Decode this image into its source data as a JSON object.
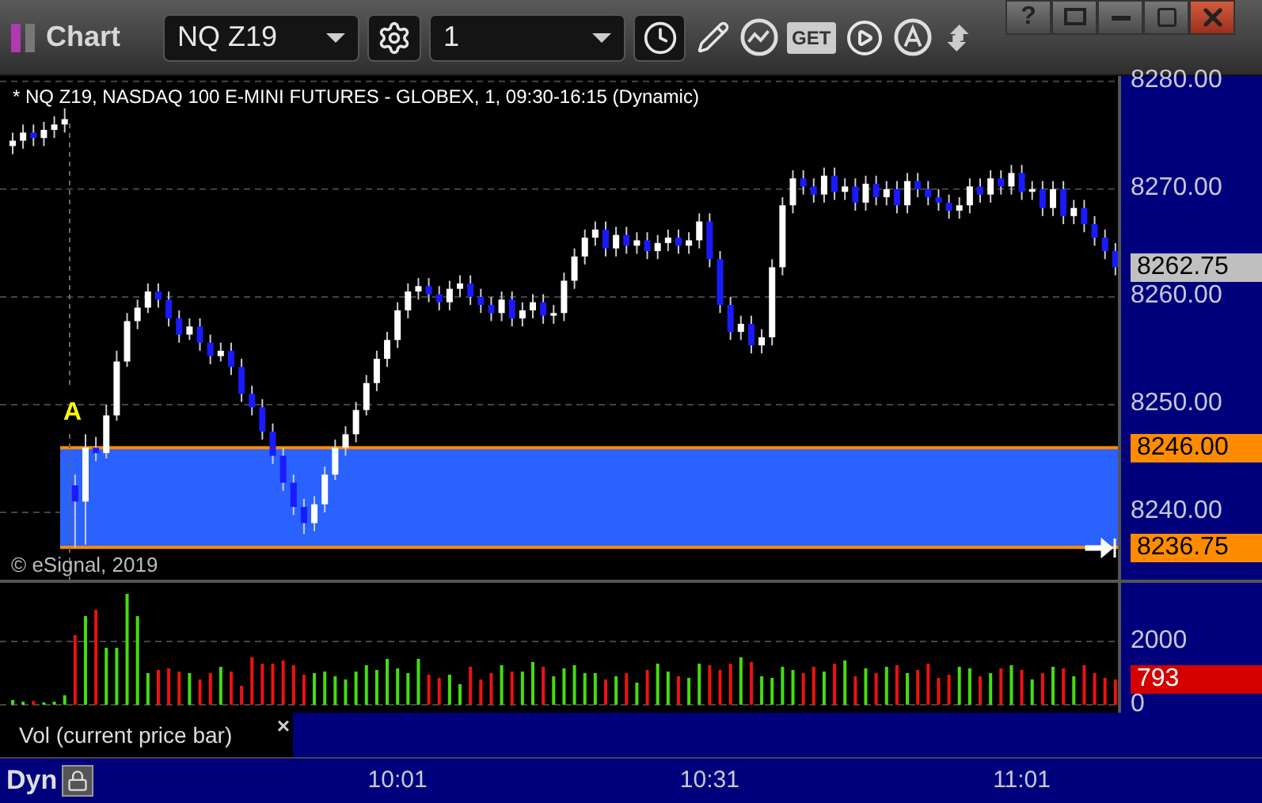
{
  "window": {
    "title": "Chart",
    "buttons": [
      "?"
    ]
  },
  "toolbar": {
    "symbol": "NQ Z19",
    "interval": "1",
    "get_label": "GET"
  },
  "price_panel": {
    "header": "* NQ Z19, NASDAQ 100 E-MINI FUTURES - GLOBEX, 1, 09:30-16:15 (Dynamic)",
    "marker": "A",
    "watermark": "© eSignal, 2019",
    "tags": [
      {
        "text": "8262.75",
        "color": "#c0c0c0"
      },
      {
        "text": "8246.00",
        "color": "#ff8c00"
      },
      {
        "text": "8236.75",
        "color": "#ff8c00"
      }
    ],
    "chart_data": {
      "type": "candlestick",
      "ylim": [
        8233.75,
        8280.5
      ],
      "grid": true,
      "bands": [
        {
          "axis": "y",
          "from": 8236.75,
          "to": 8246,
          "color": "#2962ff"
        }
      ],
      "ref_lines": [
        {
          "axis": "y",
          "value": 8246,
          "color": "#ff8c00"
        },
        {
          "axis": "y",
          "value": 8236.75,
          "color": "#ff8c00"
        }
      ],
      "yticks": [
        {
          "value": 8280,
          "label": "8280.00"
        },
        {
          "value": 8270,
          "label": "8270.00"
        },
        {
          "value": 8260,
          "label": "8260.00"
        },
        {
          "value": 8250,
          "label": "8250.00"
        },
        {
          "value": 8240,
          "label": "8240.00"
        }
      ],
      "ohlc": [
        [
          8274,
          8275.25,
          8273.25,
          8274.5
        ],
        [
          8274.5,
          8276,
          8273.75,
          8275.25
        ],
        [
          8275.25,
          8276,
          8274,
          8274.75
        ],
        [
          8274.75,
          8276.25,
          8274,
          8275.5
        ],
        [
          8275.5,
          8276.75,
          8274.75,
          8276
        ],
        [
          8276,
          8277.5,
          8275.25,
          8276.5
        ],
        [
          8242.5,
          8243.5,
          8236.75,
          8241
        ],
        [
          8241,
          8247.25,
          8237,
          8246
        ],
        [
          8246,
          8247,
          8244.75,
          8245.5
        ],
        [
          8245.5,
          8250,
          8245,
          8249
        ],
        [
          8249,
          8255,
          8248.5,
          8254
        ],
        [
          8254,
          8258.5,
          8253.5,
          8257.75
        ],
        [
          8257.75,
          8259.75,
          8257,
          8259
        ],
        [
          8259,
          8261.25,
          8258.5,
          8260.5
        ],
        [
          8260.5,
          8261.25,
          8259,
          8259.75
        ],
        [
          8259.75,
          8260.5,
          8257.25,
          8258
        ],
        [
          8258,
          8258.75,
          8255.75,
          8256.5
        ],
        [
          8256.5,
          8258,
          8256,
          8257.25
        ],
        [
          8257.25,
          8258,
          8255,
          8255.75
        ],
        [
          8255.75,
          8256.5,
          8253.75,
          8254.5
        ],
        [
          8254.5,
          8255.75,
          8254,
          8255
        ],
        [
          8255,
          8255.75,
          8252.75,
          8253.5
        ],
        [
          8253.5,
          8254.25,
          8250.25,
          8251
        ],
        [
          8251,
          8251.75,
          8249,
          8249.75
        ],
        [
          8249.75,
          8250.5,
          8246.75,
          8247.5
        ],
        [
          8247.5,
          8248.25,
          8244.5,
          8245.25
        ],
        [
          8245.25,
          8246,
          8242,
          8242.75
        ],
        [
          8242.75,
          8243.5,
          8239.75,
          8240.5
        ],
        [
          8240.5,
          8241.25,
          8238,
          8239
        ],
        [
          8239,
          8241.5,
          8238.25,
          8240.75
        ],
        [
          8240.75,
          8244.25,
          8240,
          8243.5
        ],
        [
          8243.5,
          8246.75,
          8243,
          8246
        ],
        [
          8246,
          8248,
          8245.25,
          8247.25
        ],
        [
          8247.25,
          8250.25,
          8246.5,
          8249.5
        ],
        [
          8249.5,
          8252.75,
          8249,
          8252
        ],
        [
          8252,
          8255,
          8251.25,
          8254.25
        ],
        [
          8254.25,
          8256.75,
          8253.5,
          8256
        ],
        [
          8256,
          8259.5,
          8255.25,
          8258.75
        ],
        [
          8258.75,
          8261.25,
          8258,
          8260.5
        ],
        [
          8260.5,
          8261.75,
          8259.75,
          8261
        ],
        [
          8261,
          8261.75,
          8259.5,
          8260.25
        ],
        [
          8260.25,
          8261,
          8258.75,
          8259.5
        ],
        [
          8259.5,
          8261.5,
          8258.75,
          8260.75
        ],
        [
          8260.75,
          8262,
          8260,
          8261.25
        ],
        [
          8261.25,
          8262,
          8259.25,
          8260
        ],
        [
          8260,
          8260.75,
          8258.5,
          8259.25
        ],
        [
          8259.25,
          8260,
          8257.75,
          8258.5
        ],
        [
          8258.5,
          8260.5,
          8257.75,
          8259.75
        ],
        [
          8259.75,
          8260.5,
          8257.25,
          8258
        ],
        [
          8258,
          8259.5,
          8257.25,
          8258.75
        ],
        [
          8258.75,
          8260.25,
          8258,
          8259.5
        ],
        [
          8259.5,
          8260.25,
          8257.5,
          8258.25
        ],
        [
          8258.25,
          8259.25,
          8257.5,
          8258.5
        ],
        [
          8258.5,
          8262.25,
          8257.75,
          8261.5
        ],
        [
          8261.5,
          8264.5,
          8260.75,
          8263.75
        ],
        [
          8263.75,
          8266.25,
          8263,
          8265.5
        ],
        [
          8265.5,
          8267,
          8264.75,
          8266.25
        ],
        [
          8266.25,
          8267,
          8263.75,
          8264.5
        ],
        [
          8264.5,
          8266.5,
          8263.75,
          8265.75
        ],
        [
          8265.75,
          8266.5,
          8264,
          8264.75
        ],
        [
          8264.75,
          8266,
          8264,
          8265.25
        ],
        [
          8265.25,
          8266,
          8263.5,
          8264.25
        ],
        [
          8264.25,
          8265.75,
          8263.5,
          8265
        ],
        [
          8265,
          8266.25,
          8264.25,
          8265.5
        ],
        [
          8265.5,
          8266.25,
          8264,
          8264.75
        ],
        [
          8264.75,
          8266,
          8264,
          8265.25
        ],
        [
          8265.25,
          8267.75,
          8264.5,
          8267
        ],
        [
          8267,
          8267.75,
          8262.75,
          8263.5
        ],
        [
          8263.5,
          8264.25,
          8258.5,
          8259.25
        ],
        [
          8259.25,
          8260,
          8256,
          8256.75
        ],
        [
          8256.75,
          8258.25,
          8256,
          8257.5
        ],
        [
          8257.5,
          8258.25,
          8254.75,
          8255.5
        ],
        [
          8255.5,
          8257,
          8254.75,
          8256.25
        ],
        [
          8256.25,
          8263.5,
          8255.5,
          8262.75
        ],
        [
          8262.75,
          8269.25,
          8262,
          8268.5
        ],
        [
          8268.5,
          8271.75,
          8267.75,
          8271
        ],
        [
          8271,
          8271.75,
          8269.5,
          8270.25
        ],
        [
          8270.25,
          8271,
          8268.75,
          8269.5
        ],
        [
          8269.5,
          8272,
          8268.75,
          8271.25
        ],
        [
          8271.25,
          8272,
          8269,
          8269.75
        ],
        [
          8269.75,
          8271,
          8269,
          8270.25
        ],
        [
          8270.25,
          8271,
          8268,
          8268.75
        ],
        [
          8268.75,
          8271.25,
          8268,
          8270.5
        ],
        [
          8270.5,
          8271.25,
          8268.5,
          8269.25
        ],
        [
          8269.25,
          8270.75,
          8268.5,
          8270
        ],
        [
          8270,
          8270.75,
          8267.75,
          8268.5
        ],
        [
          8268.5,
          8271.5,
          8267.75,
          8270.75
        ],
        [
          8270.75,
          8271.5,
          8269.25,
          8270
        ],
        [
          8270,
          8270.75,
          8268.5,
          8269.25
        ],
        [
          8269.25,
          8270,
          8268,
          8268.75
        ],
        [
          8268.75,
          8269.5,
          8267.25,
          8268
        ],
        [
          8268,
          8269.25,
          8267.25,
          8268.5
        ],
        [
          8268.5,
          8271,
          8267.75,
          8270.25
        ],
        [
          8270.25,
          8271,
          8268.75,
          8269.5
        ],
        [
          8269.5,
          8271.75,
          8268.75,
          8271
        ],
        [
          8271,
          8271.75,
          8269.5,
          8270.25
        ],
        [
          8270.25,
          8272.25,
          8269.5,
          8271.5
        ],
        [
          8271.5,
          8272.25,
          8269,
          8269.75
        ],
        [
          8269.75,
          8270.75,
          8269,
          8270
        ],
        [
          8270,
          8270.75,
          8267.5,
          8268.25
        ],
        [
          8268.25,
          8270.75,
          8267.5,
          8270
        ],
        [
          8270,
          8270.75,
          8266.75,
          8267.5
        ],
        [
          8267.5,
          8269,
          8266.75,
          8268.25
        ],
        [
          8268.25,
          8269,
          8266,
          8266.75
        ],
        [
          8266.75,
          8267.5,
          8264.75,
          8265.5
        ],
        [
          8265.5,
          8266.25,
          8263.5,
          8264.25
        ],
        [
          8264.25,
          8265,
          8262,
          8262.75
        ]
      ]
    }
  },
  "volume_panel": {
    "tags": [
      {
        "text": "793",
        "color": "#d40000"
      }
    ],
    "legend": "Vol (current price bar)",
    "close": "×",
    "chart_data": {
      "type": "bar",
      "ylim": [
        -250,
        3850
      ],
      "grid": true,
      "yticks": [
        {
          "value": 2000,
          "label": "2000"
        },
        {
          "value": 0,
          "label": "0"
        }
      ],
      "series": [
        {
          "values": [
            150,
            100,
            120,
            80,
            100,
            300,
            2200,
            2800,
            3000,
            1800,
            1800,
            3500,
            2800,
            1000,
            1100,
            1150,
            1050,
            1000,
            800,
            1000,
            1200,
            1050,
            600,
            1500,
            1300,
            1300,
            1400,
            1250,
            950,
            1000,
            1050,
            900,
            800,
            1050,
            1250,
            1100,
            1450,
            1150,
            1000,
            1450,
            950,
            850,
            950,
            650,
            1200,
            800,
            1000,
            1250,
            1050,
            1050,
            1350,
            1200,
            900,
            1150,
            1250,
            1000,
            1000,
            800,
            900,
            1000,
            700,
            1100,
            1300,
            1050,
            900,
            850,
            1300,
            1250,
            1100,
            1300,
            1500,
            1350,
            900,
            850,
            1200,
            1100,
            1000,
            1200,
            1050,
            1300,
            1400,
            900,
            1150,
            1000,
            1200,
            1250,
            1000,
            1100,
            1300,
            850,
            950,
            1200,
            1150,
            900,
            1000,
            1150,
            1250,
            1100,
            800,
            1000,
            1200,
            1150,
            900,
            1250,
            1000,
            850,
            800
          ]
        }
      ]
    }
  },
  "time_axis": {
    "mode": "Dyn",
    "labels": [
      "10:01",
      "10:31",
      "11:01"
    ]
  }
}
